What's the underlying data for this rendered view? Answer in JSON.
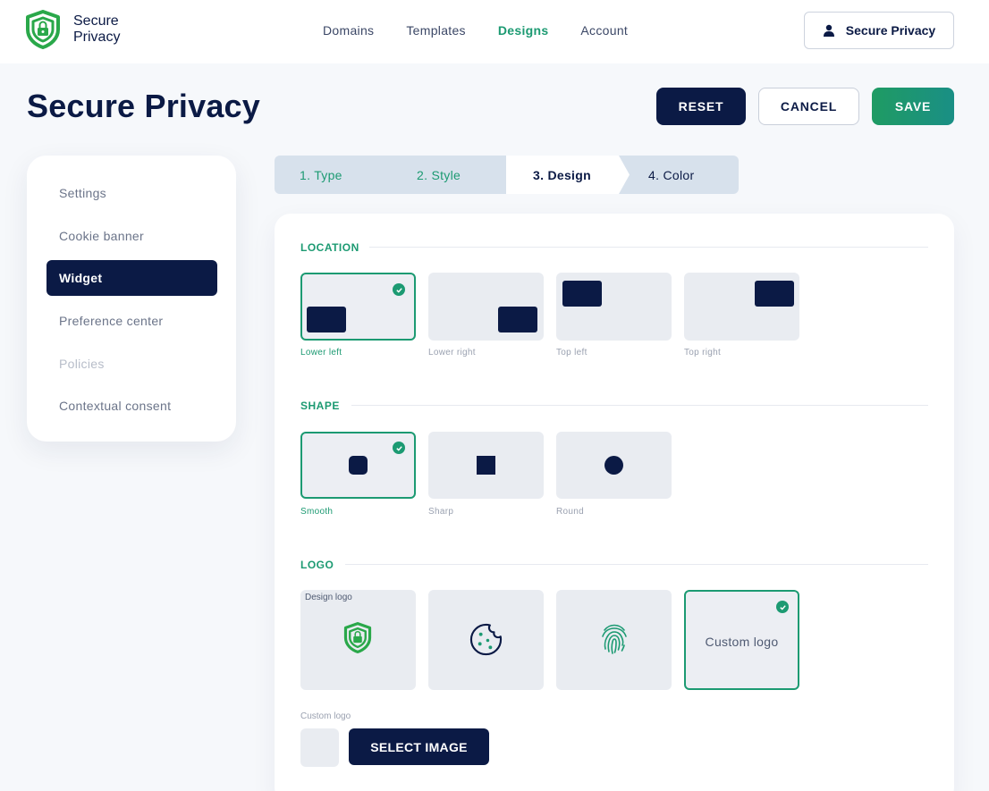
{
  "brand": {
    "line1": "Secure",
    "line2": "Privacy"
  },
  "nav": [
    {
      "label": "Domains",
      "active": false
    },
    {
      "label": "Templates",
      "active": false
    },
    {
      "label": "Designs",
      "active": true
    },
    {
      "label": "Account",
      "active": false
    }
  ],
  "account_button": {
    "label": "Secure Privacy",
    "icon": "user-icon"
  },
  "page_title": "Secure Privacy",
  "actions": {
    "reset": "RESET",
    "cancel": "CANCEL",
    "save": "SAVE"
  },
  "sidebar": {
    "items": [
      {
        "label": "Settings",
        "state": "normal"
      },
      {
        "label": "Cookie banner",
        "state": "normal"
      },
      {
        "label": "Widget",
        "state": "active"
      },
      {
        "label": "Preference center",
        "state": "normal"
      },
      {
        "label": "Policies",
        "state": "disabled"
      },
      {
        "label": "Contextual consent",
        "state": "normal"
      }
    ]
  },
  "stepper": {
    "steps": [
      {
        "label": "1. Type",
        "state": "done"
      },
      {
        "label": "2. Style",
        "state": "done"
      },
      {
        "label": "3. Design",
        "state": "current"
      },
      {
        "label": "4. Color",
        "state": "todo"
      }
    ]
  },
  "location": {
    "title": "LOCATION",
    "options": [
      {
        "label": "Lower left",
        "selected": true
      },
      {
        "label": "Lower right",
        "selected": false
      },
      {
        "label": "Top left",
        "selected": false
      },
      {
        "label": "Top right",
        "selected": false
      }
    ]
  },
  "shape": {
    "title": "SHAPE",
    "options": [
      {
        "label": "Smooth",
        "selected": true
      },
      {
        "label": "Sharp",
        "selected": false
      },
      {
        "label": "Round",
        "selected": false
      }
    ]
  },
  "logo": {
    "title": "LOGO",
    "design_logo_tag": "Design logo",
    "options": [
      {
        "icon": "shield-logo-icon",
        "selected": false
      },
      {
        "icon": "cookie-icon",
        "selected": false
      },
      {
        "icon": "fingerprint-icon",
        "selected": false
      },
      {
        "label": "Custom logo",
        "selected": true
      }
    ],
    "custom_label": "Custom logo",
    "select_button": "SELECT IMAGE"
  },
  "colors": {
    "navy": "#0b1a45",
    "green": "#1c9a72",
    "tile": "#e9ecf1"
  }
}
